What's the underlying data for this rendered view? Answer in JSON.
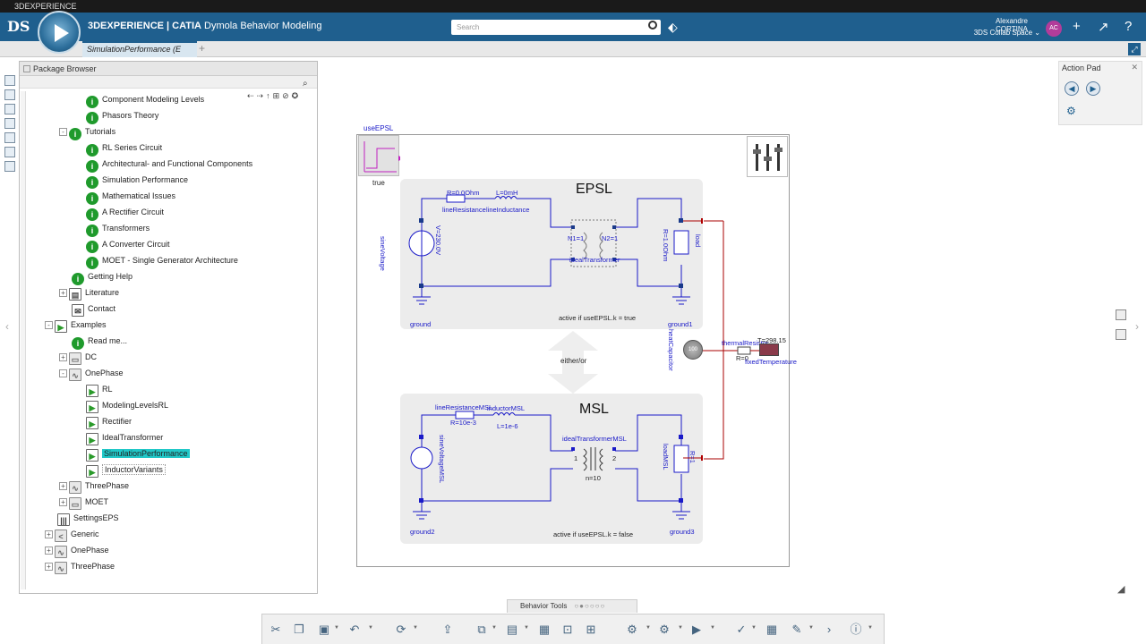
{
  "os_title": "3DEXPERIENCE",
  "header": {
    "logo": "DS",
    "brand": "3DEXPERIENCE | CATIA",
    "app": " Dymola Behavior Modeling",
    "search_placeholder": "Search",
    "user_name": "Alexandre CORTINA",
    "collab_space": "3DS Collab Space ⌄",
    "avatar_initials": "AC"
  },
  "tab": {
    "label": "SimulationPerformance (E",
    "add": "+"
  },
  "browser": {
    "title": "Package Browser",
    "tools": "⇠⇢↑⊞⊘✪",
    "items": [
      {
        "label": "Component Modeling Levels",
        "icon": "i"
      },
      {
        "label": "Phasors Theory",
        "icon": "i"
      },
      {
        "label": "Tutorials",
        "icon": "i"
      },
      {
        "label": "RL Series Circuit",
        "icon": "i"
      },
      {
        "label": "Architectural- and Functional Components",
        "icon": "i"
      },
      {
        "label": "Simulation Performance",
        "icon": "i"
      },
      {
        "label": "Mathematical Issues",
        "icon": "i"
      },
      {
        "label": "A Rectifier Circuit",
        "icon": "i"
      },
      {
        "label": "Transformers",
        "icon": "i"
      },
      {
        "label": "A Converter Circuit",
        "icon": "i"
      },
      {
        "label": "MOET - Single Generator Architecture",
        "icon": "i"
      },
      {
        "label": "Getting Help",
        "icon": "i"
      },
      {
        "label": "Literature",
        "icon": "▤"
      },
      {
        "label": "Contact",
        "icon": "✉"
      },
      {
        "label": "Examples",
        "icon": "▶"
      },
      {
        "label": "Read me...",
        "icon": "i"
      },
      {
        "label": "DC",
        "icon": "▭"
      },
      {
        "label": "OnePhase",
        "icon": "∿"
      },
      {
        "label": "RL",
        "icon": "▶"
      },
      {
        "label": "ModelingLevelsRL",
        "icon": "▶"
      },
      {
        "label": "Rectifier",
        "icon": "▶"
      },
      {
        "label": "IdealTransformer",
        "icon": "▶"
      },
      {
        "label": "SimulationPerformance",
        "icon": "▶"
      },
      {
        "label": "InductorVariants",
        "icon": "▶"
      },
      {
        "label": "ThreePhase",
        "icon": "∿"
      },
      {
        "label": "MOET",
        "icon": "▭"
      },
      {
        "label": "SettingsEPS",
        "icon": "|||"
      },
      {
        "label": "Generic",
        "icon": "<"
      },
      {
        "label": "OnePhase",
        "icon": "∿"
      },
      {
        "label": "ThreePhase",
        "icon": "∿"
      }
    ]
  },
  "diagram": {
    "useepsl_name": "useEPSL",
    "useepsl_value": "true",
    "epsl": {
      "title": "EPSL",
      "line_resistance": "lineResistance",
      "line_inductance": "lineInductance",
      "r_value": "R=0.0Ohm",
      "l_value": "L=0mH",
      "source": "sineVoltage",
      "source_value": "V=230.0V",
      "transformer": "idealTransformer",
      "transformer_n1": "N1=1",
      "transformer_n2": "N2=1",
      "load": "load",
      "load_value": "R=1.0Ohm",
      "ground": "ground",
      "ground1": "ground1",
      "active": "active if useEPSL.k = true"
    },
    "either": "either/or",
    "msl": {
      "title": "MSL",
      "line_resistance": "lineResistanceMSL",
      "inductor": "inductorMSL",
      "r_value": "R=10e-3",
      "l_value": "L=1e-6",
      "source": "sineVoltageMSL",
      "transformer": "idealTransformerMSL",
      "n_value": "n=10",
      "port1": "1",
      "port2": "2",
      "load": "loadMSL",
      "load_value": "R=1",
      "ground2": "ground2",
      "ground3": "ground3",
      "active": "active if useEPSL.k = false"
    },
    "heat_capacitor": "heatCapacitor",
    "heat_capacitor_value": "100",
    "thermal_resistor": "thermalResistor",
    "fixed_temperature": "fixedTemperature",
    "temperature_value": "T=298.15",
    "r_thermal": "R=0"
  },
  "action_pad": {
    "title": "Action Pad",
    "close": "✕"
  },
  "bottom": {
    "tab_label": "Behavior Tools",
    "tab_dots": "○●○○○○"
  }
}
